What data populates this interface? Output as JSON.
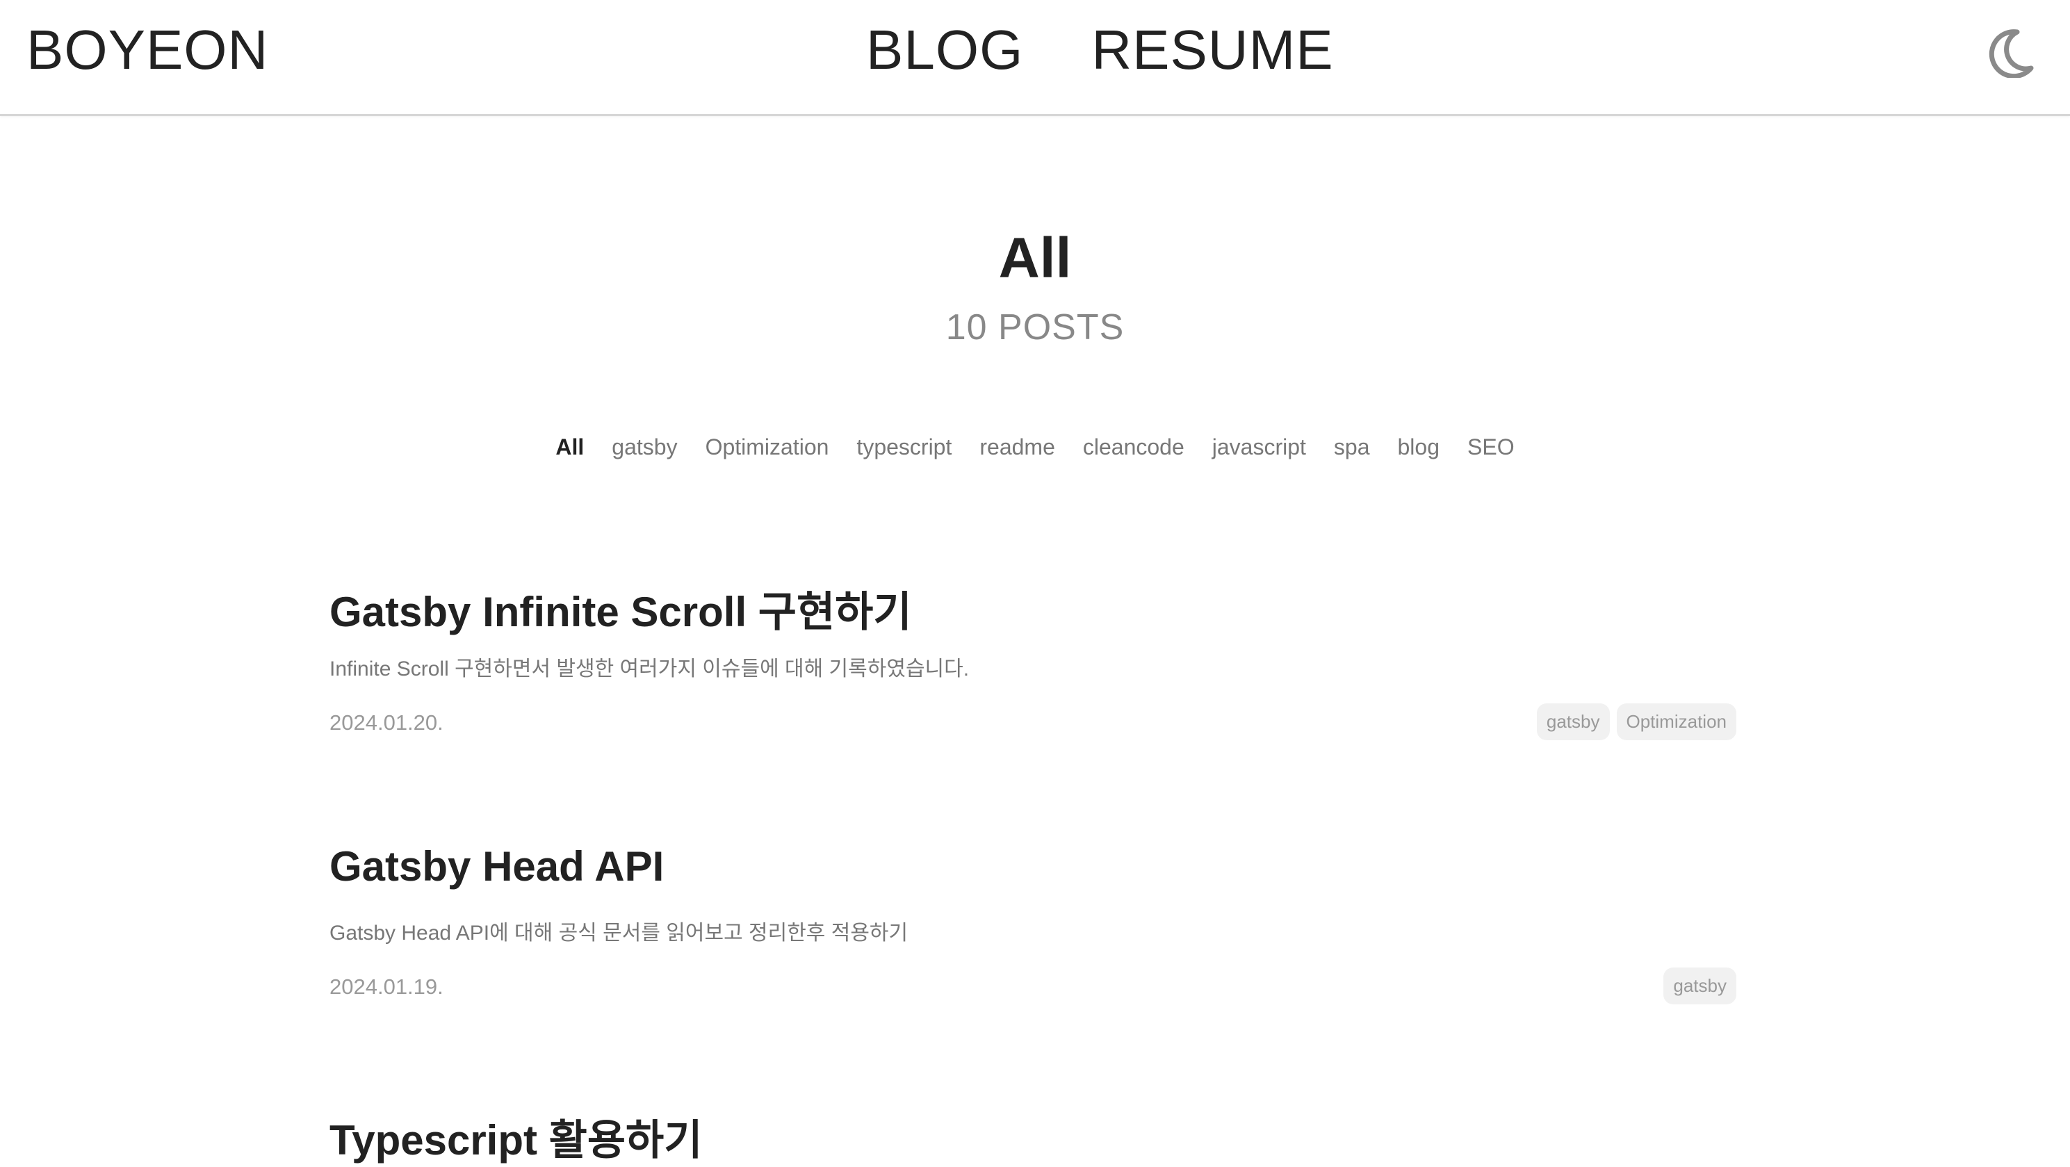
{
  "header": {
    "logo": "BOYEON",
    "nav": [
      "BLOG",
      "RESUME"
    ],
    "theme_toggle_icon": "moon-icon"
  },
  "hero": {
    "title": "All",
    "post_count": "10 POSTS"
  },
  "categories": [
    "All",
    "gatsby",
    "Optimization",
    "typescript",
    "readme",
    "cleancode",
    "javascript",
    "spa",
    "blog",
    "SEO"
  ],
  "posts": [
    {
      "title": "Gatsby Infinite Scroll 구현하기",
      "description": "Infinite Scroll 구현하면서 발생한 여러가지 이슈들에 대해 기록하였습니다.",
      "date": "2024.01.20.",
      "tags": [
        "gatsby",
        "Optimization"
      ]
    },
    {
      "title": "Gatsby Head API",
      "description": "Gatsby Head API에 대해 공식 문서를 읽어보고 정리한후 적용하기",
      "date": "2024.01.19.",
      "tags": [
        "gatsby"
      ]
    },
    {
      "title": "Typescript 활용하기"
    }
  ]
}
